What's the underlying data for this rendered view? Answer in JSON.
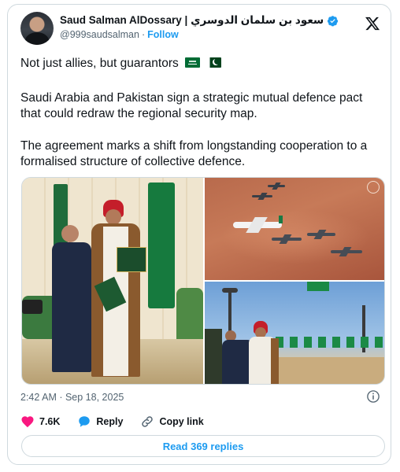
{
  "author": {
    "display_name": "Saud Salman AlDossary | سعود بن سلمان الدوسري",
    "handle": "@999saudsalman",
    "follow_label": "Follow",
    "verified": true
  },
  "post": {
    "headline": "Not just allies, but guarantors",
    "paragraph_1": "Saudi Arabia and Pakistan sign a strategic mutual defence pact that could redraw the regional security map.",
    "paragraph_2": "The agreement marks a shift from longstanding cooperation to a formalised structure of collective defence.",
    "flags": [
      "saudi-arabia-flag",
      "pakistan-flag"
    ],
    "timestamp": "2:42 AM · Sep 18, 2025"
  },
  "media": {
    "photo_count": 3
  },
  "actions": {
    "like_count": "7.6K",
    "reply_label": "Reply",
    "copy_link_label": "Copy link"
  },
  "footer": {
    "read_replies_label": "Read 369 replies"
  },
  "colors": {
    "accent": "#1d9bf0",
    "like": "#f91880",
    "text": "#0f1419",
    "muted": "#536471",
    "border": "#cfd9de"
  }
}
